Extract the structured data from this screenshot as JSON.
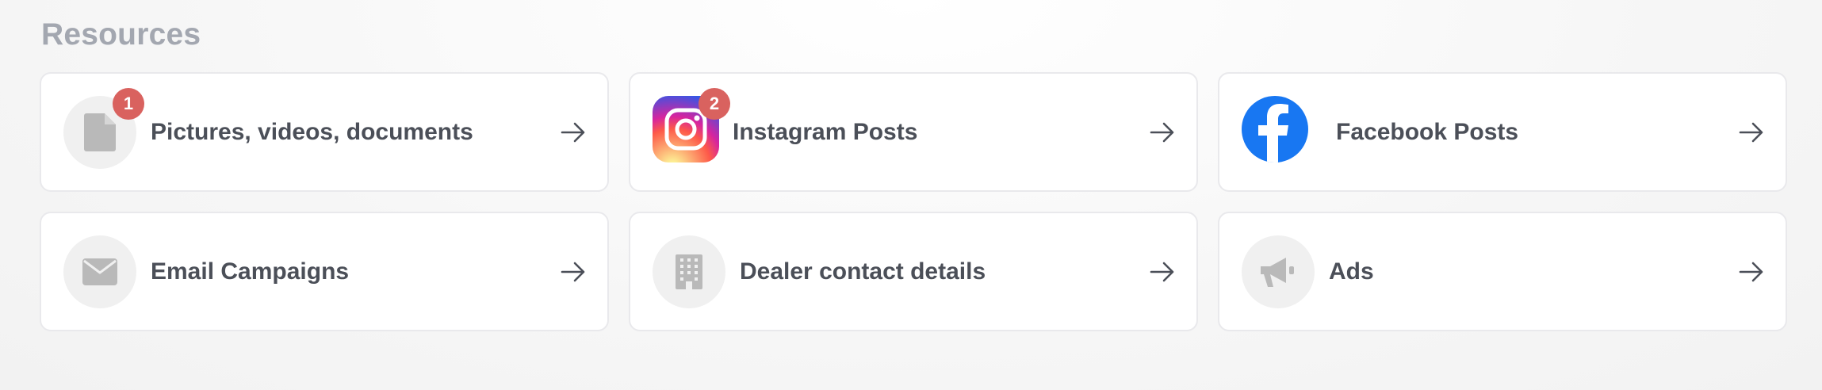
{
  "section": {
    "title": "Resources"
  },
  "cards": [
    {
      "label": "Pictures, videos, documents",
      "icon": "document-icon",
      "badge": "1"
    },
    {
      "label": "Instagram Posts",
      "icon": "instagram-icon",
      "badge": "2"
    },
    {
      "label": "Facebook Posts",
      "icon": "facebook-icon"
    },
    {
      "label": "Email Campaigns",
      "icon": "envelope-icon"
    },
    {
      "label": "Dealer contact details",
      "icon": "building-icon"
    },
    {
      "label": "Ads",
      "icon": "megaphone-icon"
    }
  ],
  "colors": {
    "badge": "#d9625f",
    "title": "#a3a7b0",
    "label": "#4b4f58",
    "icon_gray": "#b9b9b9",
    "facebook": "#1877f2"
  }
}
